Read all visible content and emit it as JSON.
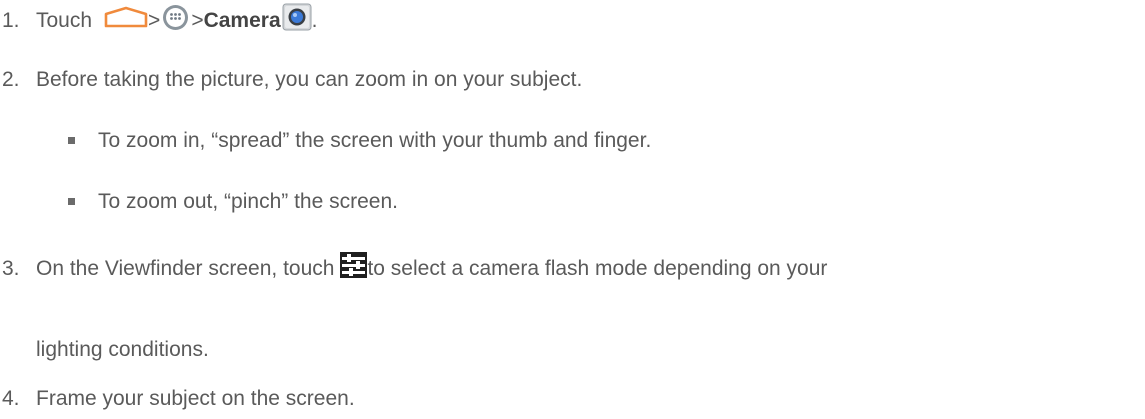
{
  "steps": [
    {
      "num": "1.",
      "text_before": "Touch",
      "sep1": ">",
      "sep2": ">",
      "bold": "Camera",
      "after": ".",
      "icons": [
        "home-icon",
        "apps-icon",
        "camera-app-icon"
      ]
    },
    {
      "num": "2.",
      "text": "Before taking the picture, you can zoom in on your subject."
    },
    {
      "num": "3.",
      "text_before": "On the Viewfinder screen, touch",
      "text_after": "to select a camera flash mode depending on your",
      "text_line2": "lighting conditions.",
      "icons": [
        "settings-sliders-icon"
      ]
    },
    {
      "num": "4.",
      "text": "Frame your subject on the screen."
    }
  ],
  "bullets": [
    "To zoom in, “spread” the screen with your thumb and finger.",
    "To zoom out, “pinch” the screen."
  ],
  "colors": {
    "text": "#5a5a5a",
    "home_icon": "#f08a3c",
    "apps_icon": "#6f7a84",
    "camera_icon": "#3b7ad8",
    "sliders_icon": "#2b2b2b"
  }
}
